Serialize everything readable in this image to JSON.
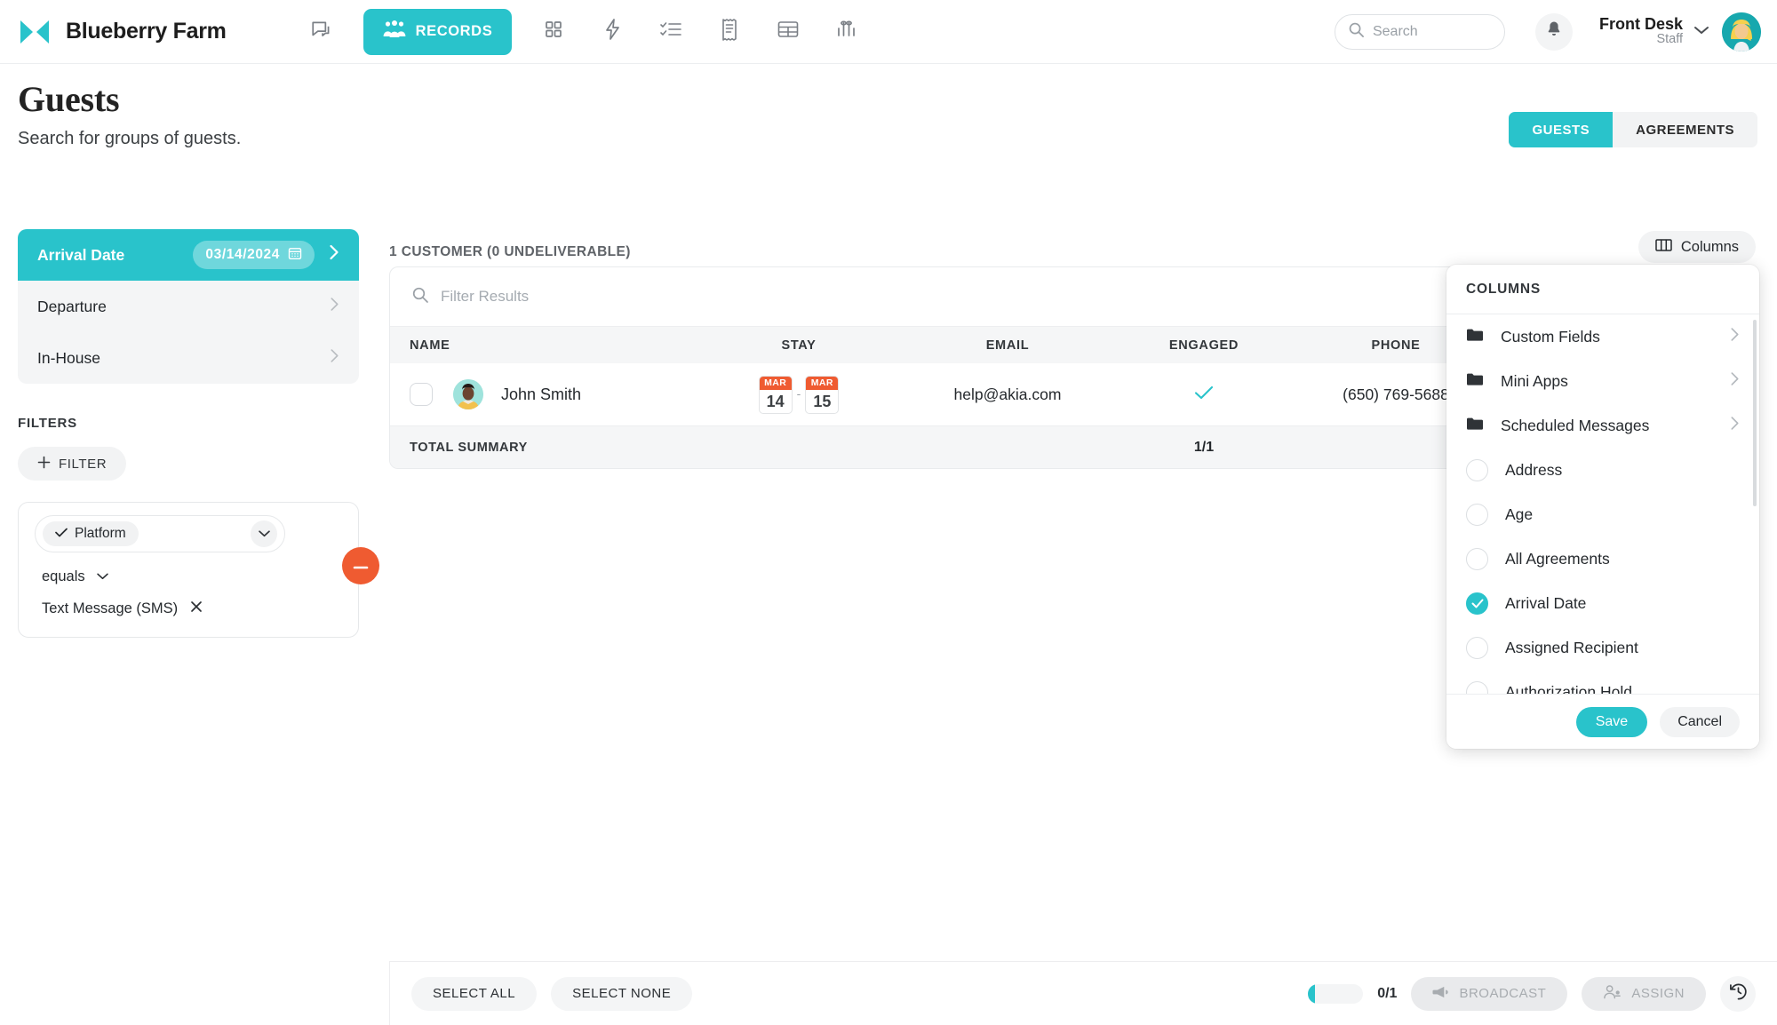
{
  "topnav": {
    "logo_icon": "akia-logo-icon",
    "brand": "Blueberry Farm",
    "items": [
      {
        "icon": "chat-bubbles-icon",
        "label": ""
      },
      {
        "icon": "records-people-icon",
        "label": "RECORDS"
      },
      {
        "icon": "grid-apps-icon",
        "label": ""
      },
      {
        "icon": "lightning-bolt-icon",
        "label": ""
      },
      {
        "icon": "checklist-icon",
        "label": ""
      },
      {
        "icon": "receipt-icon",
        "label": ""
      },
      {
        "icon": "table-icon",
        "label": ""
      },
      {
        "icon": "bar-chart-icon",
        "label": ""
      }
    ],
    "search_placeholder": "Search",
    "bell_icon": "notification-bell-icon",
    "user_name": "Front Desk",
    "user_role": "Staff"
  },
  "page": {
    "title": "Guests",
    "subtitle": "Search for groups of guests.",
    "tabs": [
      {
        "label": "GUESTS",
        "active": true
      },
      {
        "label": "AGREEMENTS",
        "active": false
      }
    ]
  },
  "sidebar": {
    "date_rows": [
      {
        "label": "Arrival Date",
        "value": "03/14/2024",
        "active": true
      },
      {
        "label": "Departure",
        "value": "",
        "active": false
      },
      {
        "label": "In-House",
        "value": "",
        "active": false
      }
    ],
    "filters_label": "FILTERS",
    "add_filter_label": "FILTER",
    "filter": {
      "field": "Platform",
      "operator": "equals",
      "value": "Text Message (SMS)"
    }
  },
  "main": {
    "count_text": "1 CUSTOMER (0 UNDELIVERABLE)",
    "filter_placeholder": "Filter Results",
    "columns": [
      "NAME",
      "STAY",
      "EMAIL",
      "ENGAGED",
      "PHONE"
    ],
    "row": {
      "name": "John Smith",
      "stay_from_month": "MAR",
      "stay_from_day": "14",
      "stay_to_month": "MAR",
      "stay_to_day": "15",
      "email": "help@akia.com",
      "engaged": true,
      "phone": "(650) 769-5688"
    },
    "summary_label": "TOTAL SUMMARY",
    "summary_engaged": "1/1"
  },
  "columns_panel": {
    "trigger_label": "Columns",
    "trigger_icon": "columns-icon",
    "header": "COLUMNS",
    "groups": [
      {
        "label": "Custom Fields",
        "icon": "folder-icon"
      },
      {
        "label": "Mini Apps",
        "icon": "folder-icon"
      },
      {
        "label": "Scheduled Messages",
        "icon": "folder-icon"
      }
    ],
    "options": [
      {
        "label": "Address",
        "checked": false
      },
      {
        "label": "Age",
        "checked": false
      },
      {
        "label": "All Agreements",
        "checked": false
      },
      {
        "label": "Arrival Date",
        "checked": true
      },
      {
        "label": "Assigned Recipient",
        "checked": false
      },
      {
        "label": "Authorization Hold",
        "checked": false
      }
    ],
    "save_label": "Save",
    "cancel_label": "Cancel"
  },
  "bottombar": {
    "select_all": "SELECT ALL",
    "select_none": "SELECT NONE",
    "progress_text": "0/1",
    "broadcast_label": "BROADCAST",
    "assign_label": "ASSIGN",
    "history_icon": "history-icon"
  },
  "colors": {
    "accent": "#29c3cb",
    "orange": "#ef5b31",
    "panel_bg": "#f4f5f6"
  }
}
